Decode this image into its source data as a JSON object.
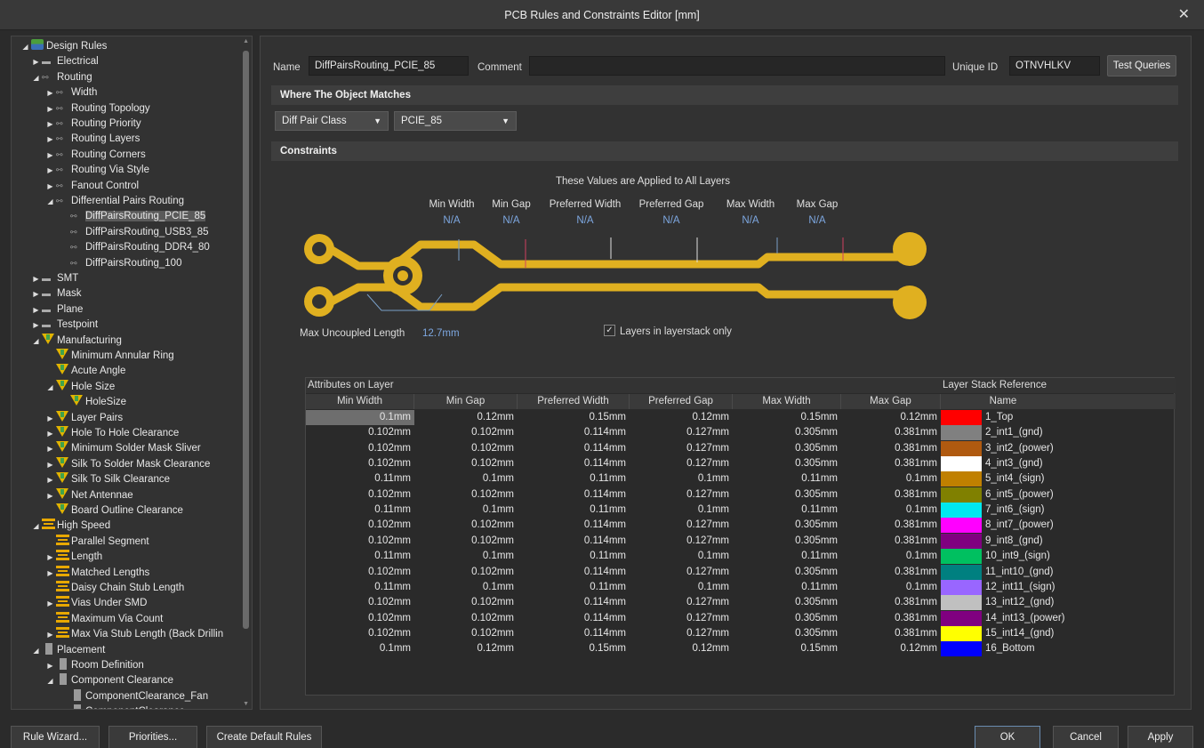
{
  "window": {
    "title": "PCB Rules and Constraints Editor [mm]",
    "close_glyph": "✕"
  },
  "tree": {
    "items": [
      {
        "label": "Design Rules",
        "level": 0,
        "tw": "◢",
        "icon": "rule"
      },
      {
        "label": "Electrical",
        "level": 1,
        "tw": "▶",
        "icon": "gray"
      },
      {
        "label": "Routing",
        "level": 1,
        "tw": "◢",
        "icon": "route"
      },
      {
        "label": "Width",
        "level": 2,
        "tw": "▶",
        "icon": "route"
      },
      {
        "label": "Routing Topology",
        "level": 2,
        "tw": "▶",
        "icon": "route"
      },
      {
        "label": "Routing Priority",
        "level": 2,
        "tw": "▶",
        "icon": "route"
      },
      {
        "label": "Routing Layers",
        "level": 2,
        "tw": "▶",
        "icon": "route"
      },
      {
        "label": "Routing Corners",
        "level": 2,
        "tw": "▶",
        "icon": "route"
      },
      {
        "label": "Routing Via Style",
        "level": 2,
        "tw": "▶",
        "icon": "route"
      },
      {
        "label": "Fanout Control",
        "level": 2,
        "tw": "▶",
        "icon": "route"
      },
      {
        "label": "Differential Pairs Routing",
        "level": 2,
        "tw": "◢",
        "icon": "route"
      },
      {
        "label": "DiffPairsRouting_PCIE_85",
        "level": 3,
        "tw": "",
        "icon": "route",
        "selected": true
      },
      {
        "label": "DiffPairsRouting_USB3_85",
        "level": 3,
        "tw": "",
        "icon": "route"
      },
      {
        "label": "DiffPairsRouting_DDR4_80",
        "level": 3,
        "tw": "",
        "icon": "route"
      },
      {
        "label": "DiffPairsRouting_100",
        "level": 3,
        "tw": "",
        "icon": "route"
      },
      {
        "label": "SMT",
        "level": 1,
        "tw": "▶",
        "icon": "gray"
      },
      {
        "label": "Mask",
        "level": 1,
        "tw": "▶",
        "icon": "gray"
      },
      {
        "label": "Plane",
        "level": 1,
        "tw": "▶",
        "icon": "gray"
      },
      {
        "label": "Testpoint",
        "level": 1,
        "tw": "▶",
        "icon": "gray"
      },
      {
        "label": "Manufacturing",
        "level": 1,
        "tw": "◢",
        "icon": "mfg"
      },
      {
        "label": "Minimum Annular Ring",
        "level": 2,
        "tw": "",
        "icon": "mfg"
      },
      {
        "label": "Acute Angle",
        "level": 2,
        "tw": "",
        "icon": "mfg"
      },
      {
        "label": "Hole Size",
        "level": 2,
        "tw": "◢",
        "icon": "mfg"
      },
      {
        "label": "HoleSize",
        "level": 3,
        "tw": "",
        "icon": "mfg"
      },
      {
        "label": "Layer Pairs",
        "level": 2,
        "tw": "▶",
        "icon": "mfg"
      },
      {
        "label": "Hole To Hole Clearance",
        "level": 2,
        "tw": "▶",
        "icon": "mfg"
      },
      {
        "label": "Minimum Solder Mask Sliver",
        "level": 2,
        "tw": "▶",
        "icon": "mfg"
      },
      {
        "label": "Silk To Solder Mask Clearance",
        "level": 2,
        "tw": "▶",
        "icon": "mfg"
      },
      {
        "label": "Silk To Silk Clearance",
        "level": 2,
        "tw": "▶",
        "icon": "mfg"
      },
      {
        "label": "Net Antennae",
        "level": 2,
        "tw": "▶",
        "icon": "mfg"
      },
      {
        "label": "Board Outline Clearance",
        "level": 2,
        "tw": "",
        "icon": "mfg"
      },
      {
        "label": "High Speed",
        "level": 1,
        "tw": "◢",
        "icon": "hs"
      },
      {
        "label": "Parallel Segment",
        "level": 2,
        "tw": "",
        "icon": "hs"
      },
      {
        "label": "Length",
        "level": 2,
        "tw": "▶",
        "icon": "hs"
      },
      {
        "label": "Matched Lengths",
        "level": 2,
        "tw": "▶",
        "icon": "hs"
      },
      {
        "label": "Daisy Chain Stub Length",
        "level": 2,
        "tw": "",
        "icon": "hs"
      },
      {
        "label": "Vias Under SMD",
        "level": 2,
        "tw": "▶",
        "icon": "hs"
      },
      {
        "label": "Maximum Via Count",
        "level": 2,
        "tw": "",
        "icon": "hs"
      },
      {
        "label": "Max Via Stub Length (Back Drillin",
        "level": 2,
        "tw": "▶",
        "icon": "hs"
      },
      {
        "label": "Placement",
        "level": 1,
        "tw": "◢",
        "icon": "plc"
      },
      {
        "label": "Room Definition",
        "level": 2,
        "tw": "▶",
        "icon": "plc"
      },
      {
        "label": "Component Clearance",
        "level": 2,
        "tw": "◢",
        "icon": "plc"
      },
      {
        "label": "ComponentClearance_Fan",
        "level": 3,
        "tw": "",
        "icon": "plc"
      },
      {
        "label": "ComponentClearance",
        "level": 3,
        "tw": "",
        "icon": "plc"
      }
    ]
  },
  "rule": {
    "name_label": "Name",
    "name_value": "DiffPairsRouting_PCIE_85",
    "comment_label": "Comment",
    "comment_value": "",
    "uid_label": "Unique ID",
    "uid_value": "OTNVHLKV",
    "test_queries": "Test Queries"
  },
  "where": {
    "title": "Where The Object Matches",
    "type_value": "Diff Pair Class",
    "class_value": "PCIE_85"
  },
  "constraints": {
    "title": "Constraints",
    "applied_note": "These Values are Applied to All Layers",
    "labels": [
      "Min Width",
      "Min Gap",
      "Preferred Width",
      "Preferred Gap",
      "Max Width",
      "Max Gap"
    ],
    "values": [
      "N/A",
      "N/A",
      "N/A",
      "N/A",
      "N/A",
      "N/A"
    ],
    "max_uncoupled_label": "Max Uncoupled Length",
    "max_uncoupled_value": "12.7mm",
    "layers_only_label": "Layers in layerstack only",
    "layers_only_checked": true,
    "colors": {
      "trace": "#e0b020"
    }
  },
  "layer_table": {
    "group_left": "Attributes on Layer",
    "group_right": "Layer Stack Reference",
    "headers": [
      "Min Width",
      "Min Gap",
      "Preferred Width",
      "Preferred Gap",
      "Max Width",
      "Max Gap",
      "Name"
    ],
    "rows": [
      {
        "v": [
          "0.1mm",
          "0.12mm",
          "0.15mm",
          "0.12mm",
          "0.15mm",
          "0.12mm"
        ],
        "color": "#ff0000",
        "name": "1_Top"
      },
      {
        "v": [
          "0.102mm",
          "0.102mm",
          "0.114mm",
          "0.127mm",
          "0.305mm",
          "0.381mm"
        ],
        "color": "#808080",
        "name": "2_int1_(gnd)"
      },
      {
        "v": [
          "0.102mm",
          "0.102mm",
          "0.114mm",
          "0.127mm",
          "0.305mm",
          "0.381mm"
        ],
        "color": "#b05a10",
        "name": "3_int2_(power)"
      },
      {
        "v": [
          "0.102mm",
          "0.102mm",
          "0.114mm",
          "0.127mm",
          "0.305mm",
          "0.381mm"
        ],
        "color": "#ffffff",
        "name": "4_int3_(gnd)"
      },
      {
        "v": [
          "0.11mm",
          "0.1mm",
          "0.11mm",
          "0.1mm",
          "0.11mm",
          "0.1mm"
        ],
        "color": "#c08000",
        "name": "5_int4_(sign)"
      },
      {
        "v": [
          "0.102mm",
          "0.102mm",
          "0.114mm",
          "0.127mm",
          "0.305mm",
          "0.381mm"
        ],
        "color": "#808000",
        "name": "6_int5_(power)"
      },
      {
        "v": [
          "0.11mm",
          "0.1mm",
          "0.11mm",
          "0.1mm",
          "0.11mm",
          "0.1mm"
        ],
        "color": "#00e8f0",
        "name": "7_int6_(sign)"
      },
      {
        "v": [
          "0.102mm",
          "0.102mm",
          "0.114mm",
          "0.127mm",
          "0.305mm",
          "0.381mm"
        ],
        "color": "#ff00ff",
        "name": "8_int7_(power)"
      },
      {
        "v": [
          "0.102mm",
          "0.102mm",
          "0.114mm",
          "0.127mm",
          "0.305mm",
          "0.381mm"
        ],
        "color": "#800080",
        "name": "9_int8_(gnd)"
      },
      {
        "v": [
          "0.11mm",
          "0.1mm",
          "0.11mm",
          "0.1mm",
          "0.11mm",
          "0.1mm"
        ],
        "color": "#00c060",
        "name": "10_int9_(sign)"
      },
      {
        "v": [
          "0.102mm",
          "0.102mm",
          "0.114mm",
          "0.127mm",
          "0.305mm",
          "0.381mm"
        ],
        "color": "#008080",
        "name": "11_int10_(gnd)"
      },
      {
        "v": [
          "0.11mm",
          "0.1mm",
          "0.11mm",
          "0.1mm",
          "0.11mm",
          "0.1mm"
        ],
        "color": "#9966ff",
        "name": "12_int11_(sign)"
      },
      {
        "v": [
          "0.102mm",
          "0.102mm",
          "0.114mm",
          "0.127mm",
          "0.305mm",
          "0.381mm"
        ],
        "color": "#c0c0c0",
        "name": "13_int12_(gnd)"
      },
      {
        "v": [
          "0.102mm",
          "0.102mm",
          "0.114mm",
          "0.127mm",
          "0.305mm",
          "0.381mm"
        ],
        "color": "#800080",
        "name": "14_int13_(power)"
      },
      {
        "v": [
          "0.102mm",
          "0.102mm",
          "0.114mm",
          "0.127mm",
          "0.305mm",
          "0.381mm"
        ],
        "color": "#ffff00",
        "name": "15_int14_(gnd)"
      },
      {
        "v": [
          "0.1mm",
          "0.12mm",
          "0.15mm",
          "0.12mm",
          "0.15mm",
          "0.12mm"
        ],
        "color": "#0000ff",
        "name": "16_Bottom"
      }
    ]
  },
  "footer": {
    "rule_wizard": "Rule Wizard...",
    "priorities": "Priorities...",
    "create_default": "Create Default Rules",
    "ok": "OK",
    "cancel": "Cancel",
    "apply": "Apply"
  }
}
